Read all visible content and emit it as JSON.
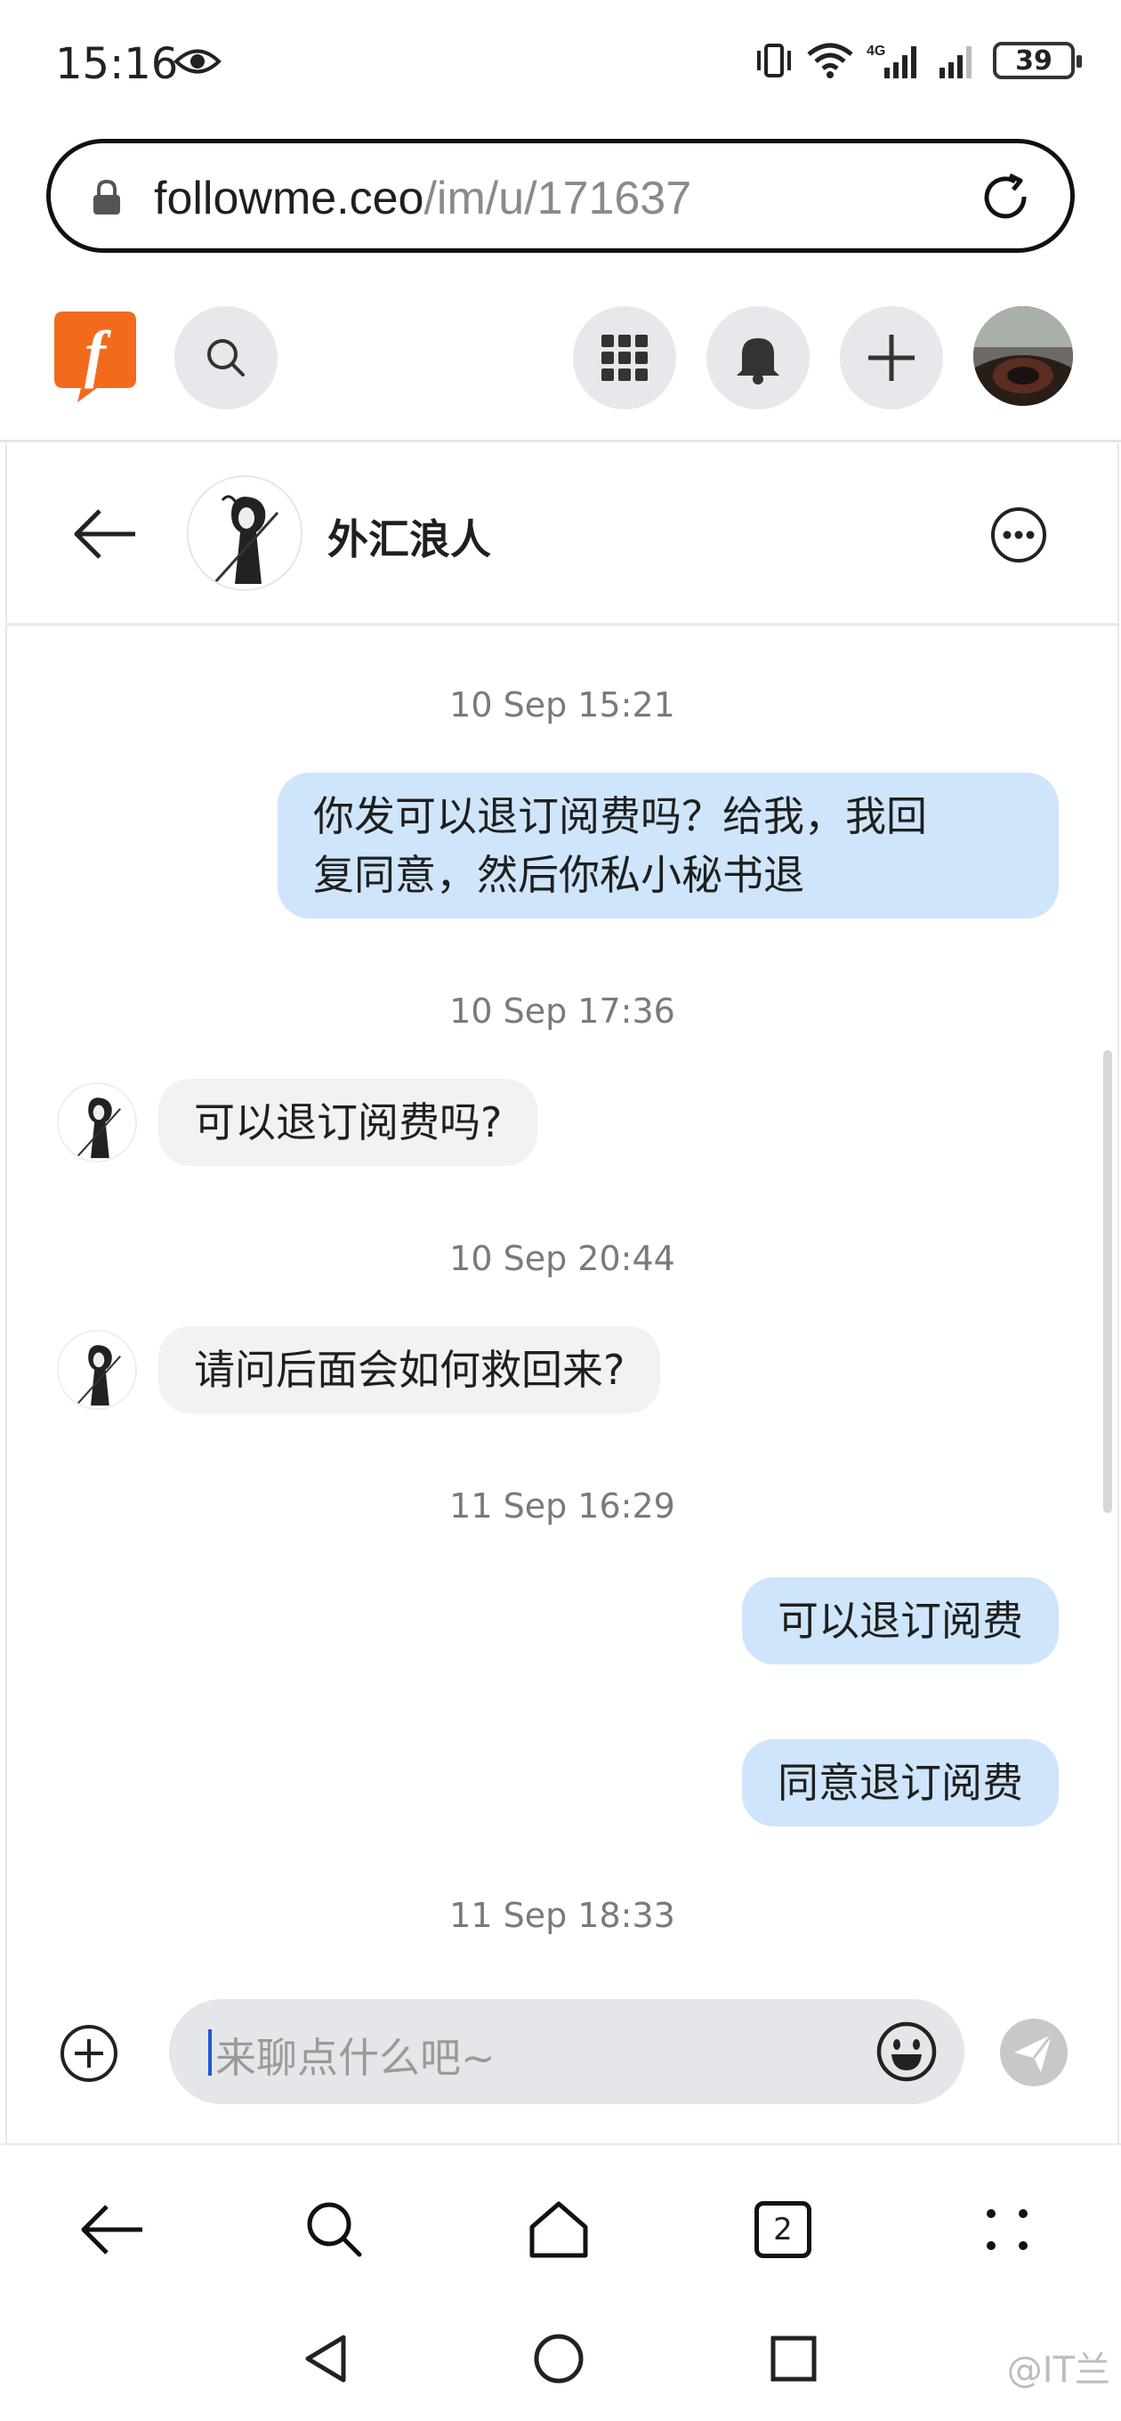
{
  "status_bar": {
    "time": "15:16",
    "battery": "39",
    "network": "4G"
  },
  "browser": {
    "url_domain": "followme.ceo",
    "url_path": "/im/u/171637",
    "tab_count": "2"
  },
  "site_nav": {
    "logo_letter": "f",
    "brand_color": "#f26b1d"
  },
  "chat": {
    "contact_name": "外汇浪人",
    "messages": [
      {
        "type": "timestamp",
        "text": "10 Sep 15:21"
      },
      {
        "type": "outgoing",
        "lines": [
          "你发可以退订阅费吗？给我，我回",
          "复同意，然后你私小秘书退"
        ]
      },
      {
        "type": "timestamp",
        "text": "10 Sep 17:36"
      },
      {
        "type": "incoming",
        "text": "可以退订阅费吗?"
      },
      {
        "type": "timestamp",
        "text": "10 Sep 20:44"
      },
      {
        "type": "incoming",
        "text": "请问后面会如何救回来?"
      },
      {
        "type": "timestamp",
        "text": "11 Sep 16:29"
      },
      {
        "type": "outgoing",
        "text": "可以退订阅费"
      },
      {
        "type": "outgoing",
        "text": "同意退订阅费"
      },
      {
        "type": "timestamp",
        "text": "11 Sep 18:33"
      }
    ],
    "input_placeholder": "来聊点什么吧~",
    "bubble_out_color": "#cfe5fb",
    "bubble_in_color": "#f1f2f4"
  },
  "icons": {
    "status": [
      "eye-icon",
      "vibrate-icon",
      "wifi-icon",
      "signal-icon",
      "battery-icon"
    ],
    "nav": [
      "search-icon",
      "apps-grid-icon",
      "bell-icon",
      "plus-icon"
    ],
    "chat": [
      "back-arrow-icon",
      "more-icon",
      "add-icon",
      "emoji-icon",
      "send-icon"
    ],
    "browser": [
      "back-icon",
      "search-icon",
      "home-icon",
      "tabs-icon",
      "menu-icon"
    ],
    "system": [
      "back-triangle-icon",
      "home-circle-icon",
      "recents-square-icon"
    ]
  },
  "watermark": "@IT兰"
}
